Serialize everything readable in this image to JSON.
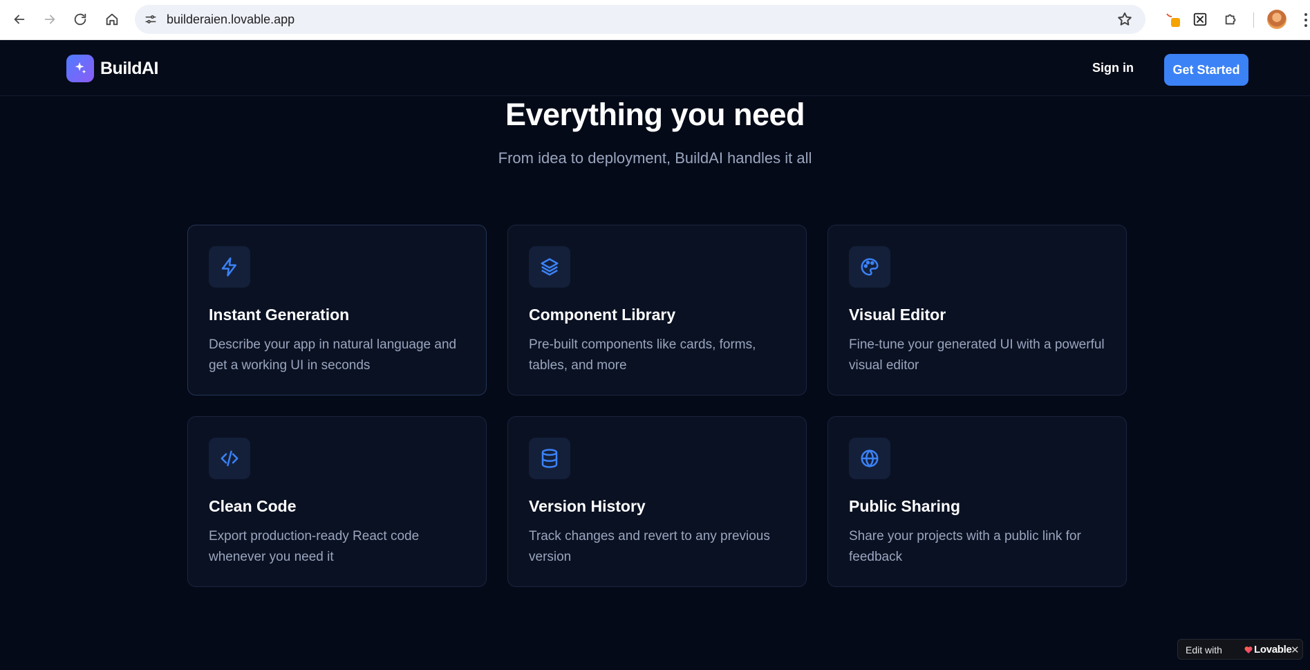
{
  "browser": {
    "url": "builderaien.lovable.app"
  },
  "header": {
    "brand": "BuildAI",
    "signin_label": "Sign in",
    "cta_label": "Get Started"
  },
  "hero": {
    "title": "Everything you need",
    "subtitle": "From idea to deployment, BuildAI handles it all"
  },
  "features": [
    {
      "icon": "lightning-icon",
      "title": "Instant Generation",
      "desc": "Describe your app in natural language and get a working UI in seconds"
    },
    {
      "icon": "layers-icon",
      "title": "Component Library",
      "desc": "Pre-built components like cards, forms, tables, and more"
    },
    {
      "icon": "palette-icon",
      "title": "Visual Editor",
      "desc": "Fine-tune your generated UI with a powerful visual editor"
    },
    {
      "icon": "code-icon",
      "title": "Clean Code",
      "desc": "Export production-ready React code whenever you need it"
    },
    {
      "icon": "database-icon",
      "title": "Version History",
      "desc": "Track changes and revert to any previous version"
    },
    {
      "icon": "globe-icon",
      "title": "Public Sharing",
      "desc": "Share your projects with a public link for feedback"
    }
  ],
  "badge": {
    "label": "Edit with",
    "brand": "Lovable",
    "close": "✕"
  },
  "colors": {
    "background": "#050a18",
    "accent": "#3b82f6",
    "card": "#0a1122"
  }
}
